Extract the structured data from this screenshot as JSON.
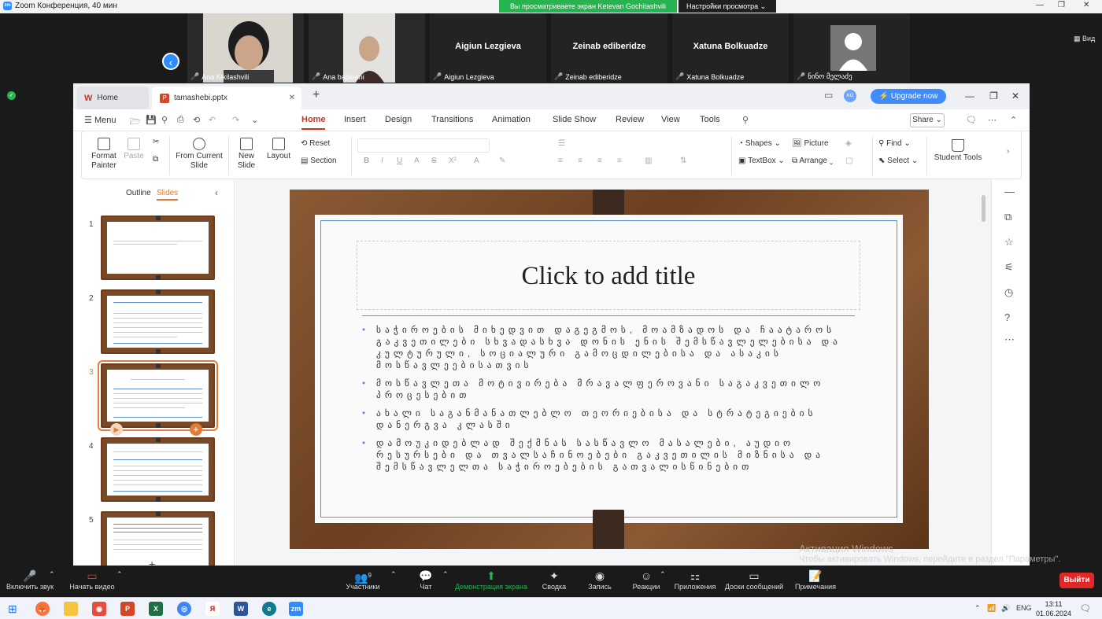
{
  "zoom": {
    "window_title": "Zoom Конференция, 40 мин",
    "share_banner": "Вы просматриваете экран Ketevan Gochitashvili",
    "view_options": "Настройки просмотра",
    "view_label": "Вид",
    "participants": [
      {
        "name": "Ana Kikilashvili",
        "big": ""
      },
      {
        "name": "Ana babluani",
        "big": ""
      },
      {
        "name": "Aigiun Lezgieva",
        "big": "Aigiun Lezgieva"
      },
      {
        "name": "Zeinab ediberidze",
        "big": "Zeinab ediberidze"
      },
      {
        "name": "Xatuna Bolkuadze",
        "big": "Xatuna Bolkuadze"
      },
      {
        "name": "ნინო მელაძე",
        "big": ""
      }
    ],
    "toolbar": {
      "audio": "Включить звук",
      "video": "Начать видео",
      "participants": "Участники",
      "participants_count": "9",
      "chat": "Чат",
      "share": "Демонстрация экрана",
      "summary": "Сводка",
      "record": "Запись",
      "reactions": "Реакции",
      "apps": "Приложения",
      "whiteboards": "Доски сообщений",
      "notes": "Примечания",
      "exit": "Выйти"
    }
  },
  "wps": {
    "tab_home": "Home",
    "tab_doc": "tamashebi.pptx",
    "avatar": "KG",
    "upgrade": "Upgrade now",
    "share": "Share",
    "menu": [
      "Menu",
      "Home",
      "Insert",
      "Design",
      "Transitions",
      "Animation",
      "Slide Show",
      "Review",
      "View",
      "Tools"
    ],
    "ribbon": {
      "format_painter": "Format Painter",
      "paste": "Paste",
      "from_current": "From Current Slide",
      "new_slide": "New Slide",
      "layout": "Layout",
      "reset": "Reset",
      "section": "Section",
      "shapes": "Shapes",
      "picture": "Picture",
      "textbox": "TextBox",
      "arrange": "Arrange",
      "find": "Find",
      "select": "Select",
      "student_tools": "Student Tools"
    },
    "left_pane": {
      "outline": "Outline",
      "slides": "Slides"
    },
    "slide": {
      "title": "Click to add title",
      "bullets": [
        "საჭიროების მიხედვით დაგეგმოს, მოამზადოს და ჩაატაროს გაკვეთილები სხვადასხვა დონის ენის შემსწავლელებისა და კულტურული, სოციალური გამოცდილებისა და ასაკის მოსწავლეებისათვის",
        "მოსწავლეთა მოტივირება მრავალფეროვანი საგაკვეთილო პროცესებით",
        "ახალი საგანმანათლებლო თეორიებისა და სტრატეგიების დანერგვა კლასში",
        "დამოუკიდებლად შექმნას სასწავლო მასალები, აუდიო რესურსები და თვალსაჩინოებები გაკვეთილის მიზნისა და შემსწავლელთა საჭიროებების გათვალისწინებით"
      ]
    },
    "slide_numbers": [
      "1",
      "2",
      "3",
      "4",
      "5"
    ]
  },
  "windows": {
    "activation_title": "Активация Windows",
    "activation_sub": "Чтобы активировать Windows, перейдите в раздел \"Параметры\".",
    "lang": "ENG",
    "time": "13:11",
    "date": "01.06.2024"
  }
}
